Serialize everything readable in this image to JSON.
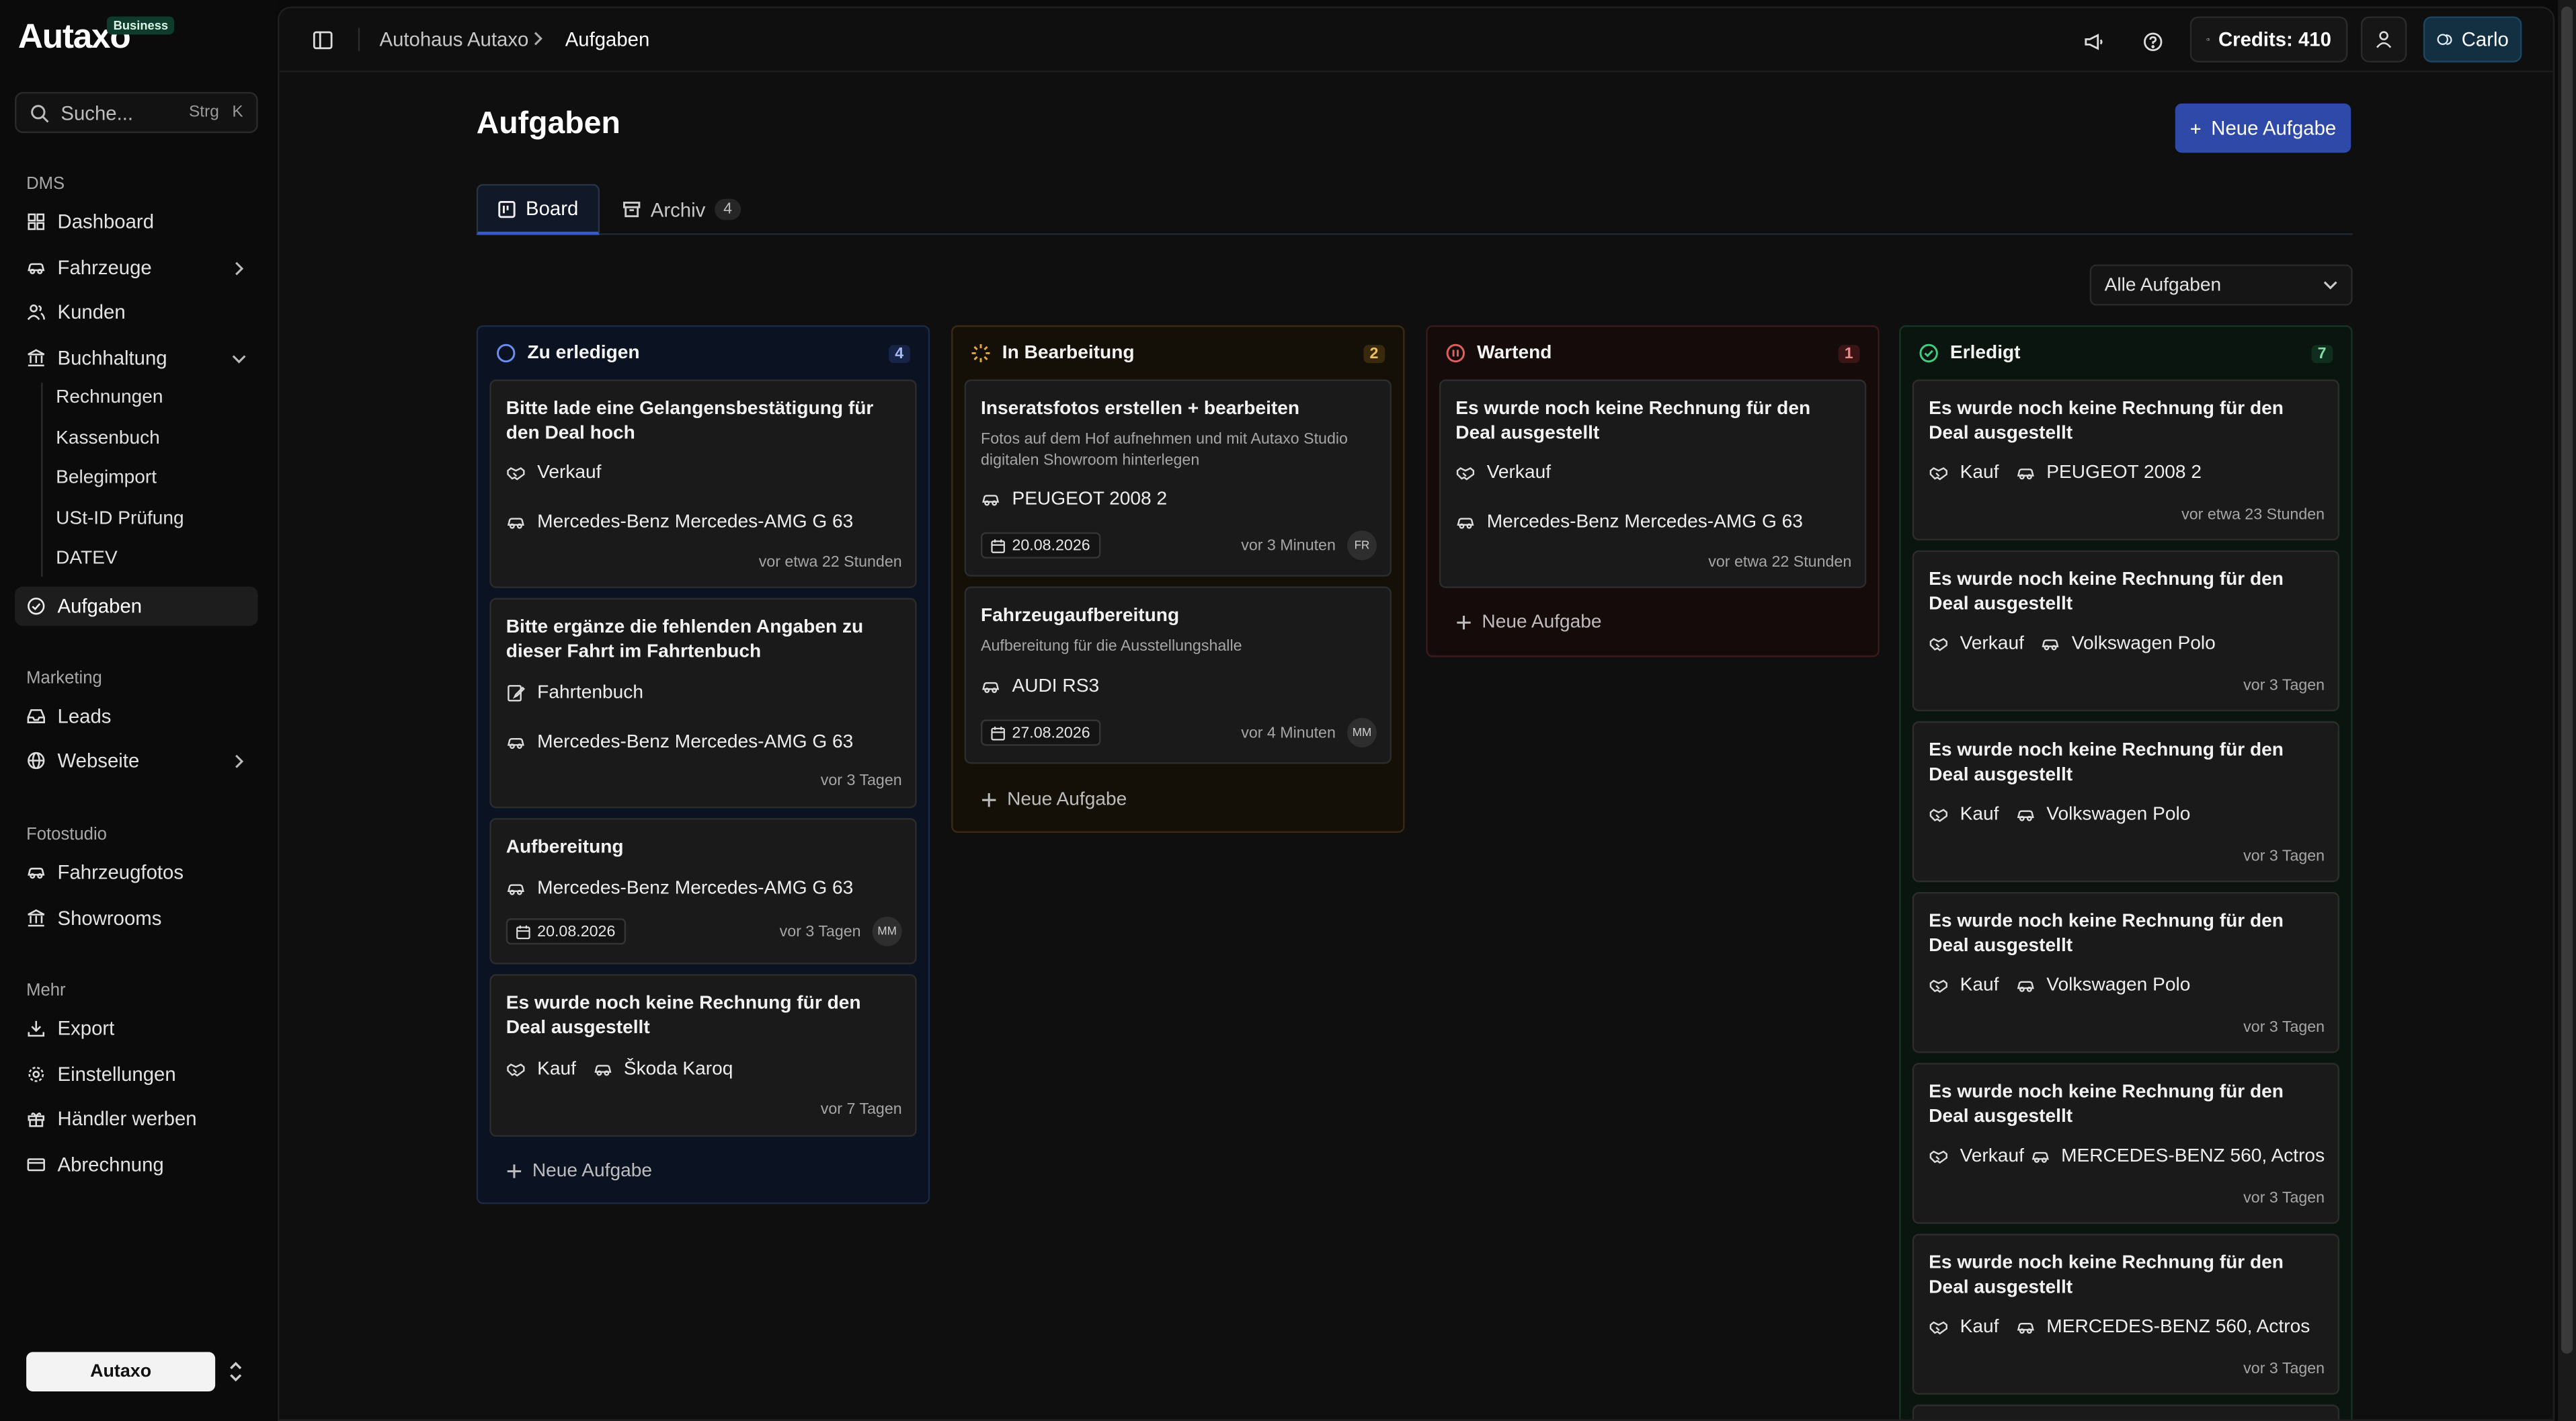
{
  "brand": {
    "logo_text": "Autaxo",
    "badge": "Business",
    "footer_logo": "Autaxo"
  },
  "search": {
    "placeholder": "Suche...",
    "shortcut_mod": "Strg",
    "shortcut_key": "K"
  },
  "sidebar": {
    "sections": {
      "dms": "DMS",
      "marketing": "Marketing",
      "fotostudio": "Fotostudio",
      "mehr": "Mehr"
    },
    "items": {
      "dashboard": "Dashboard",
      "fahrzeuge": "Fahrzeuge",
      "kunden": "Kunden",
      "buchhaltung": "Buchhaltung",
      "aufgaben": "Aufgaben",
      "leads": "Leads",
      "webseite": "Webseite",
      "fahrzeugfotos": "Fahrzeugfotos",
      "showrooms": "Showrooms",
      "export": "Export",
      "einstellungen": "Einstellungen",
      "haendler_werben": "Händler werben",
      "abrechnung": "Abrechnung"
    },
    "buchhaltung_sub": [
      "Rechnungen",
      "Kassenbuch",
      "Belegimport",
      "USt-ID Prüfung",
      "DATEV"
    ]
  },
  "topbar": {
    "breadcrumb": [
      "Autohaus Autaxo",
      "Aufgaben"
    ],
    "credits": "Credits: 410",
    "user": "Carlo"
  },
  "page": {
    "title": "Aufgaben",
    "new_task_button": "Neue Aufgabe",
    "tabs": {
      "board": "Board",
      "archive": "Archiv",
      "archive_count": "4"
    },
    "filter": "Alle Aufgaben",
    "add_task": "Neue Aufgabe"
  },
  "columns": {
    "todo": {
      "title": "Zu erledigen",
      "count": "4",
      "cards": [
        {
          "title": "Bitte lade eine Gelangensbestätigung für den Deal hoch",
          "tag": "Verkauf",
          "vehicle": "Mercedes-Benz Mercedes-AMG G 63",
          "ago": "vor etwa 22 Stunden"
        },
        {
          "title": "Bitte ergänze die fehlenden Angaben zu dieser Fahrt im Fahrtenbuch",
          "tag": "Fahrtenbuch",
          "vehicle": "Mercedes-Benz Mercedes-AMG G 63",
          "ago": "vor 3 Tagen"
        },
        {
          "title": "Aufbereitung",
          "vehicle": "Mercedes-Benz Mercedes-AMG G 63",
          "date": "20.08.2026",
          "ago": "vor 3 Tagen",
          "avatar": "MM"
        },
        {
          "title": "Es wurde noch keine Rechnung für den Deal ausgestellt",
          "tag": "Kauf",
          "vehicle": "Škoda Karoq",
          "ago": "vor 7 Tagen"
        }
      ]
    },
    "progress": {
      "title": "In Bearbeitung",
      "count": "2",
      "cards": [
        {
          "title": "Inseratsfotos erstellen + bearbeiten",
          "desc": "Fotos auf dem Hof aufnehmen und mit Autaxo Studio digitalen Showroom hinterlegen",
          "vehicle": "PEUGEOT 2008 2",
          "date": "20.08.2026",
          "ago": "vor 3 Minuten",
          "avatar": "FR"
        },
        {
          "title": "Fahrzeugaufbereitung",
          "desc": "Aufbereitung für die Ausstellungshalle",
          "vehicle": "AUDI RS3",
          "date": "27.08.2026",
          "ago": "vor 4 Minuten",
          "avatar": "MM"
        }
      ]
    },
    "waiting": {
      "title": "Wartend",
      "count": "1",
      "cards": [
        {
          "title": "Es wurde noch keine Rechnung für den Deal ausgestellt",
          "tag": "Verkauf",
          "vehicle": "Mercedes-Benz Mercedes-AMG G 63",
          "ago": "vor etwa 22 Stunden"
        }
      ]
    },
    "done": {
      "title": "Erledigt",
      "count": "7",
      "cards": [
        {
          "title": "Es wurde noch keine Rechnung für den Deal ausgestellt",
          "tag": "Kauf",
          "vehicle": "PEUGEOT 2008 2",
          "ago": "vor etwa 23 Stunden"
        },
        {
          "title": "Es wurde noch keine Rechnung für den Deal ausgestellt",
          "tag": "Verkauf",
          "vehicle": "Volkswagen Polo",
          "ago": "vor 3 Tagen"
        },
        {
          "title": "Es wurde noch keine Rechnung für den Deal ausgestellt",
          "tag": "Kauf",
          "vehicle": "Volkswagen Polo",
          "ago": "vor 3 Tagen"
        },
        {
          "title": "Es wurde noch keine Rechnung für den Deal ausgestellt",
          "tag": "Kauf",
          "vehicle": "Volkswagen Polo",
          "ago": "vor 3 Tagen"
        },
        {
          "title": "Es wurde noch keine Rechnung für den Deal ausgestellt",
          "tag": "Verkauf",
          "vehicle": "MERCEDES-BENZ 560, Actros",
          "ago": "vor 3 Tagen"
        },
        {
          "title": "Es wurde noch keine Rechnung für den Deal ausgestellt",
          "tag": "Kauf",
          "vehicle": "MERCEDES-BENZ 560, Actros",
          "ago": "vor 3 Tagen"
        }
      ]
    }
  }
}
